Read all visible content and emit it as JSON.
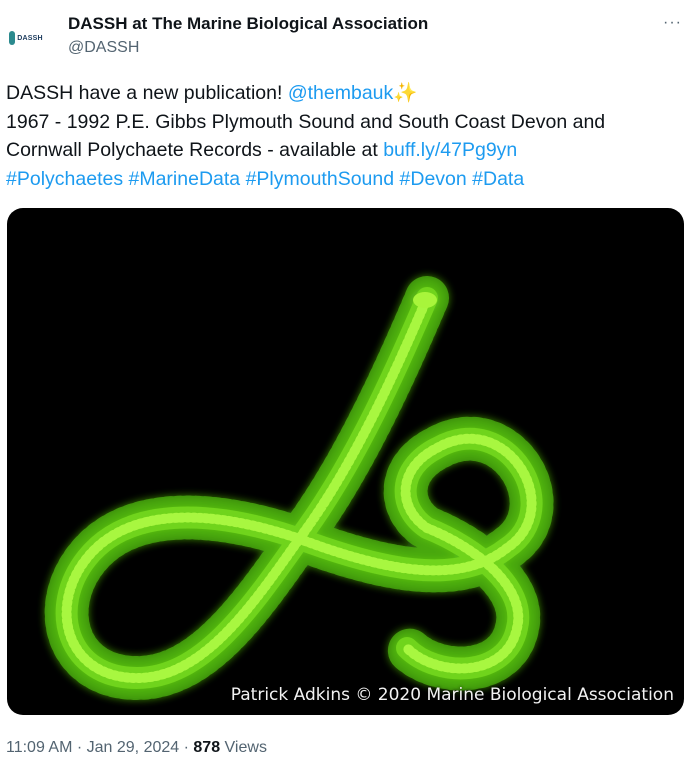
{
  "header": {
    "avatar_label": "DASSH",
    "display_name": "DASSH at The Marine Biological Association",
    "handle": "@DASSH"
  },
  "tweet": {
    "line1_prefix": "DASSH have a new publication! ",
    "mention": "@thembauk",
    "sparkle": "✨",
    "line2": "1967 - 1992 P.E. Gibbs Plymouth Sound and South Coast Devon and Cornwall Polychaete Records - available at ",
    "url": "buff.ly/47Pg9yn",
    "hashtags": [
      "#Polychaetes",
      "#MarineData",
      "#PlymouthSound",
      "#Devon",
      "#Data"
    ]
  },
  "media": {
    "credit": "Patrick Adkins © 2020 Marine Biological Association",
    "subject": "glowing green polychaete worm on black background"
  },
  "meta": {
    "time": "11:09 AM",
    "date": "Jan 29, 2024",
    "views_count": "878",
    "views_label": "Views"
  },
  "colors": {
    "link": "#1d9bf0",
    "text": "#0f1419",
    "secondary": "#536471",
    "worm": "#7ee81a"
  }
}
